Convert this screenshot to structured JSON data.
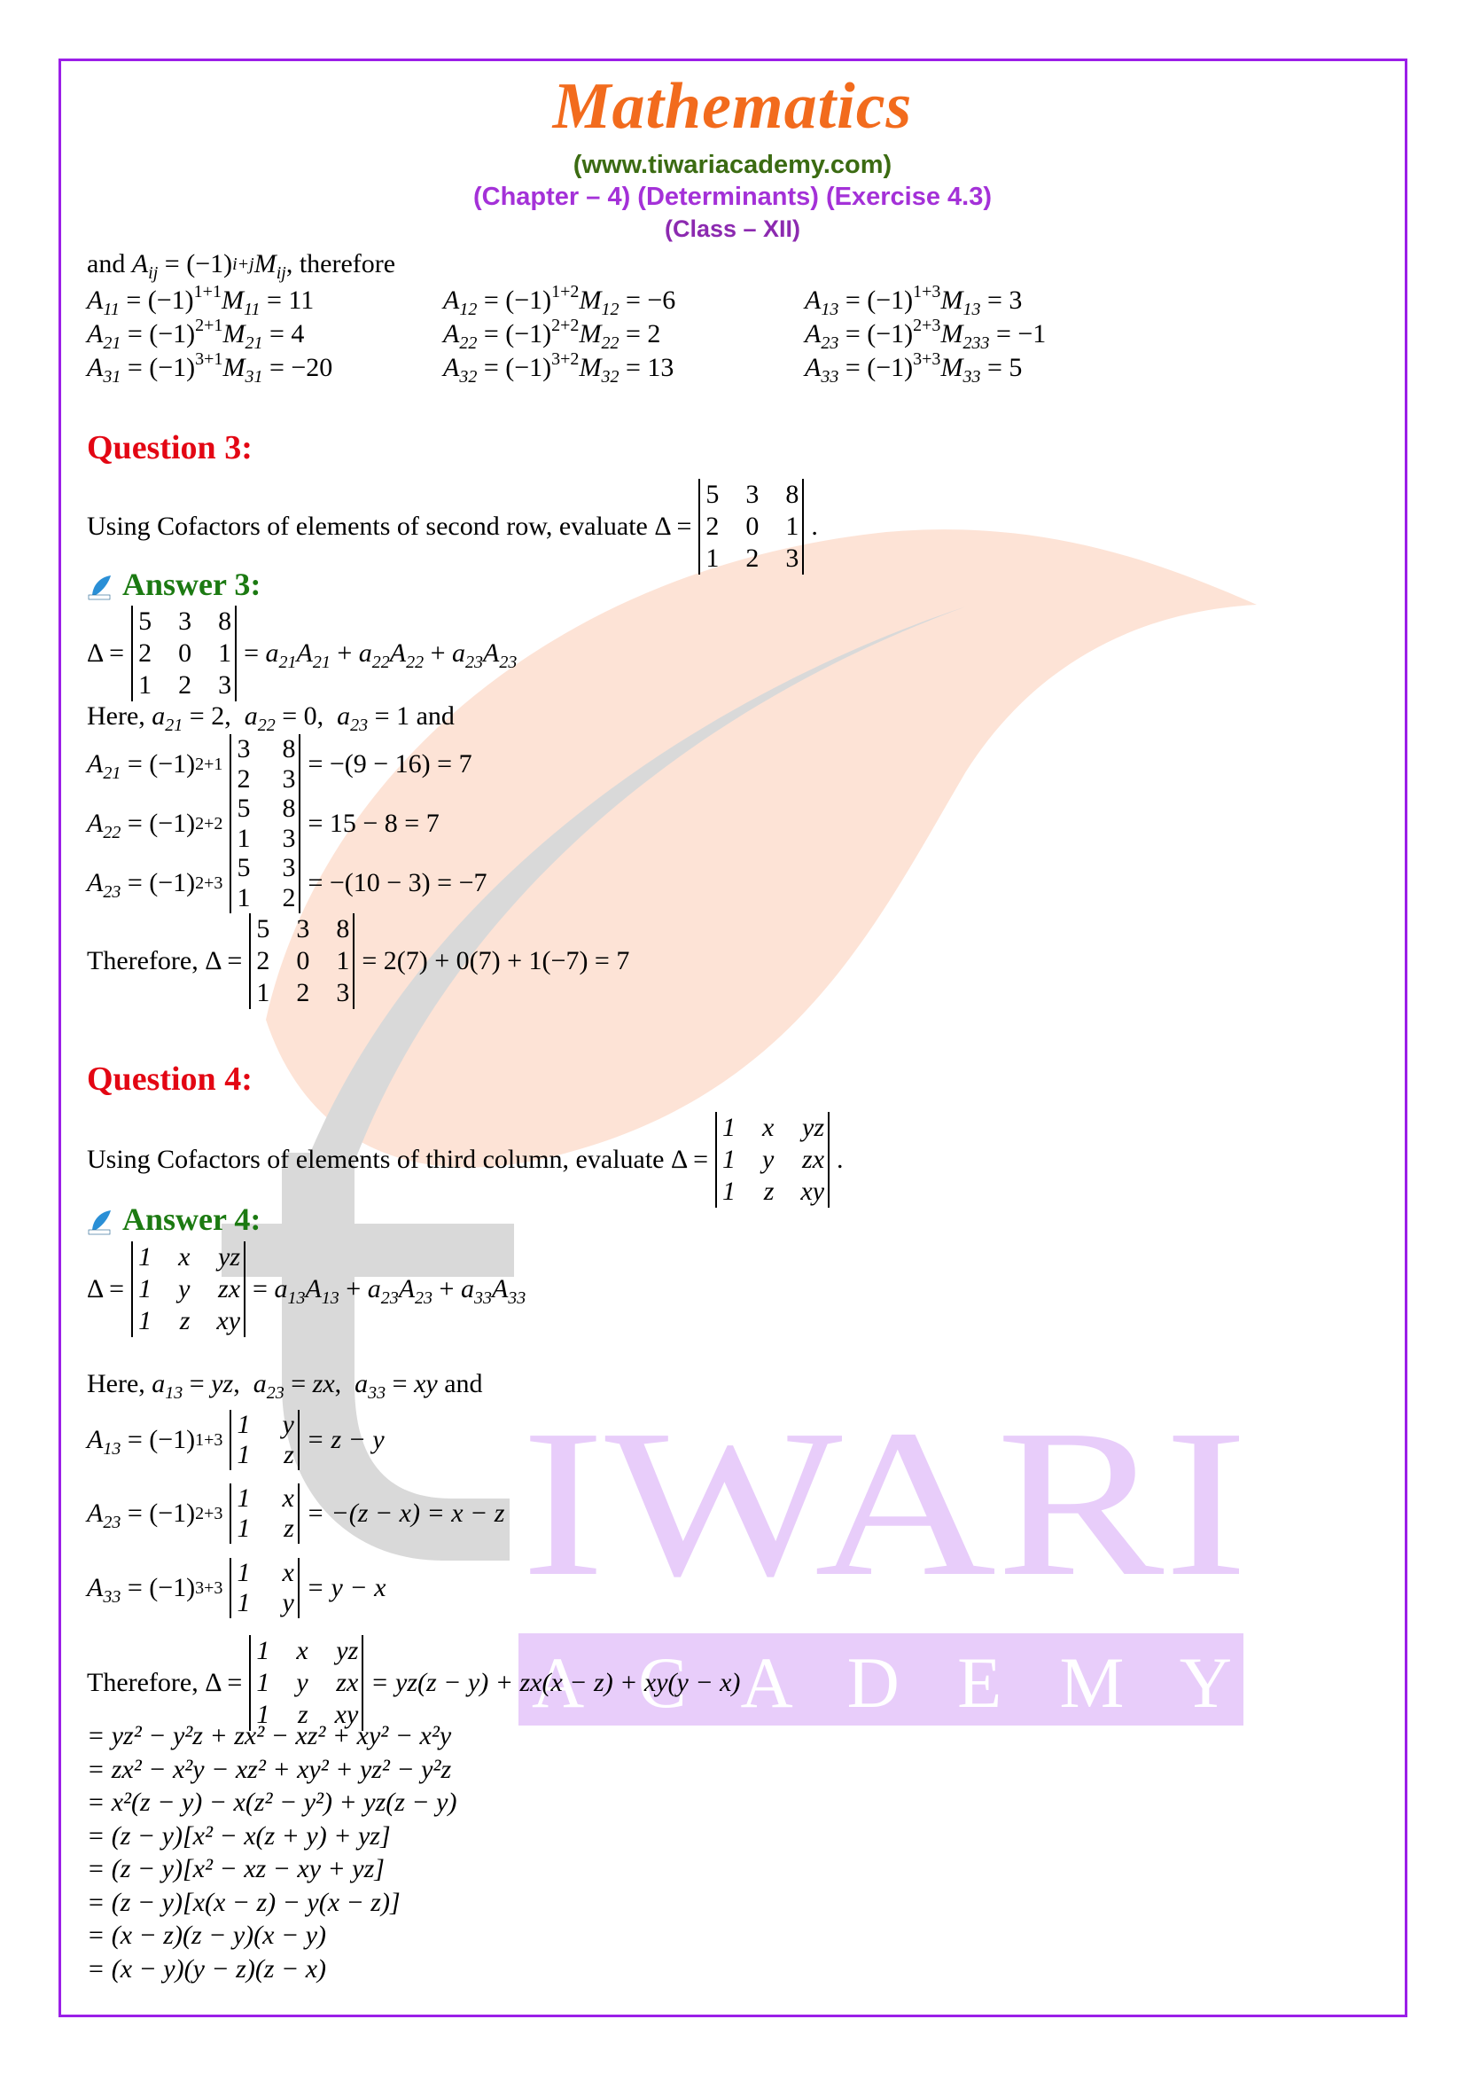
{
  "header": {
    "title": "Mathematics",
    "website": "(www.tiwariacademy.com)",
    "chapter_line": "(Chapter – 4) (Determinants) (Exercise 4.3)",
    "class_line": "(Class – XII)"
  },
  "colors": {
    "title": "#f26b1d",
    "website": "#3b6b12",
    "chapter": "#a431d8",
    "question": "#e30613",
    "answer": "#1c7a12",
    "frame": "#9b1fe8",
    "watermark_leaf": "#fde3d6",
    "watermark_t": "#d9d9d9",
    "watermark_text": "#e8cdfa"
  },
  "intro": {
    "lead": "and",
    "formula": "A_ij = (−1)^(i+j) M_ij",
    "tail": ", therefore",
    "cofactors": [
      [
        {
          "A": "11",
          "exp": "1+1",
          "M": "11",
          "val": "11"
        },
        {
          "A": "12",
          "exp": "1+2",
          "M": "12",
          "val": "−6"
        },
        {
          "A": "13",
          "exp": "1+3",
          "M": "13",
          "val": "3"
        }
      ],
      [
        {
          "A": "21",
          "exp": "2+1",
          "M": "21",
          "val": "4"
        },
        {
          "A": "22",
          "exp": "2+2",
          "M": "22",
          "val": "2"
        },
        {
          "A": "23",
          "exp": "2+3",
          "M": "233",
          "val": "−1"
        }
      ],
      [
        {
          "A": "31",
          "exp": "3+1",
          "M": "31",
          "val": "−20"
        },
        {
          "A": "32",
          "exp": "3+2",
          "M": "32",
          "val": "13"
        },
        {
          "A": "33",
          "exp": "3+3",
          "M": "33",
          "val": "5"
        }
      ]
    ]
  },
  "question3": {
    "heading": "Question 3:",
    "text": "Using Cofactors of elements of second row, evaluate Δ =",
    "matrix": [
      [
        "5",
        "3",
        "8"
      ],
      [
        "2",
        "0",
        "1"
      ],
      [
        "1",
        "2",
        "3"
      ]
    ],
    "end": "."
  },
  "answer3": {
    "heading": "Answer 3:",
    "icon_label": "tiwari",
    "delta_label": "Δ =",
    "expansion": "= a21A21 + a22A22 + a23A23",
    "here_line": {
      "prefix": "Here,",
      "items": [
        [
          "a",
          "21",
          "2"
        ],
        [
          "a",
          "22",
          "0"
        ],
        [
          "a",
          "23",
          "1"
        ]
      ],
      "suffix": "and"
    },
    "cofactors": [
      {
        "A": "21",
        "exp": "2+1",
        "minor": [
          [
            "3",
            "8"
          ],
          [
            "2",
            "3"
          ]
        ],
        "result": "= −(9 − 16) = 7"
      },
      {
        "A": "22",
        "exp": "2+2",
        "minor": [
          [
            "5",
            "8"
          ],
          [
            "1",
            "3"
          ]
        ],
        "result": "= 15 − 8 = 7"
      },
      {
        "A": "23",
        "exp": "2+3",
        "minor": [
          [
            "5",
            "3"
          ],
          [
            "1",
            "2"
          ]
        ],
        "result": "= −(10 − 3) = −7"
      }
    ],
    "therefore_label": "Therefore, Δ =",
    "final": "= 2(7) + 0(7) + 1(−7) = 7"
  },
  "question4": {
    "heading": "Question 4:",
    "text": "Using Cofactors of elements of third column, evaluate Δ =",
    "matrix": [
      [
        "1",
        "x",
        "yz"
      ],
      [
        "1",
        "y",
        "zx"
      ],
      [
        "1",
        "z",
        "xy"
      ]
    ],
    "end": "."
  },
  "answer4": {
    "heading": "Answer 4:",
    "icon_label": "tiwari",
    "delta_label": "Δ =",
    "expansion": "= a13A13 + a23A23 + a33A33",
    "here_line": {
      "prefix": "Here,",
      "items": [
        [
          "a",
          "13",
          "yz"
        ],
        [
          "a",
          "23",
          "zx"
        ],
        [
          "a",
          "33",
          "xy"
        ]
      ],
      "suffix": "and"
    },
    "cofactors": [
      {
        "A": "13",
        "exp": "1+3",
        "minor": [
          [
            "1",
            "y"
          ],
          [
            "1",
            "z"
          ]
        ],
        "result": "= z − y"
      },
      {
        "A": "23",
        "exp": "2+3",
        "minor": [
          [
            "1",
            "x"
          ],
          [
            "1",
            "z"
          ]
        ],
        "result": "= −(z − x) = x − z"
      },
      {
        "A": "33",
        "exp": "3+3",
        "minor": [
          [
            "1",
            "x"
          ],
          [
            "1",
            "y"
          ]
        ],
        "result": "= y − x"
      }
    ],
    "therefore_label": "Therefore, Δ =",
    "final": "= yz(z − y) + zx(x − z) + xy(y − x)",
    "steps": [
      "= yz² − y²z + zx² − xz² + xy² − x²y",
      "= zx² − x²y − xz² + xy² + yz² − y²z",
      "= x²(z − y) − x(z² − y²) + yz(z − y)",
      "= (z − y)[x² − x(z + y) + yz]",
      "= (z − y)[x² − xz − xy + yz]",
      "= (z − y)[x(x − z) − y(x − z)]",
      "= (x − z)(z − y)(x − y)",
      "= (x − y)(y − z)(z − x)"
    ]
  },
  "watermark": {
    "word": "IWARI",
    "sub": "A C A D E M Y"
  }
}
